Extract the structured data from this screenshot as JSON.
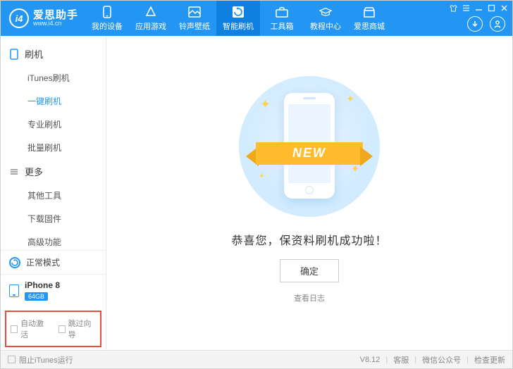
{
  "brand": {
    "badge": "i4",
    "name": "爱思助手",
    "url": "www.i4.cn"
  },
  "topnav": {
    "items": [
      {
        "label": "我的设备"
      },
      {
        "label": "应用游戏"
      },
      {
        "label": "铃声壁纸"
      },
      {
        "label": "智能刷机"
      },
      {
        "label": "工具箱"
      },
      {
        "label": "教程中心"
      },
      {
        "label": "爱思商城"
      }
    ],
    "active_index": 3
  },
  "sidebar": {
    "groups": [
      {
        "title": "刷机",
        "items": [
          "iTunes刷机",
          "一键刷机",
          "专业刷机",
          "批量刷机"
        ],
        "active_index": 1
      },
      {
        "title": "更多",
        "items": [
          "其他工具",
          "下载固件",
          "高级功能"
        ],
        "active_index": -1
      }
    ],
    "status_label": "正常模式",
    "device": {
      "name": "iPhone 8",
      "capacity": "64GB"
    },
    "checks": {
      "auto_activate": "自动激活",
      "skip_guide": "跳过向导"
    }
  },
  "main": {
    "ribbon_text": "NEW",
    "success_text": "恭喜您，保资料刷机成功啦！",
    "ok_label": "确定",
    "log_label": "查看日志"
  },
  "footer": {
    "block_itunes": "阻止iTunes运行",
    "version": "V8.12",
    "links": [
      "客服",
      "微信公众号",
      "检查更新"
    ]
  }
}
